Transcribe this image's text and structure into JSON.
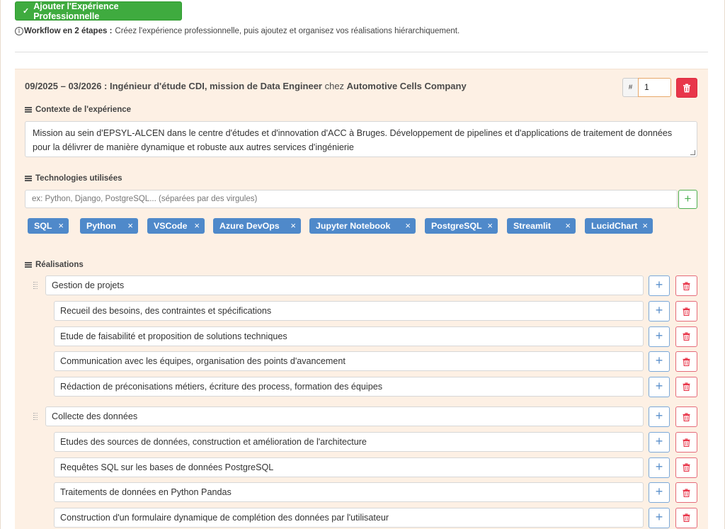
{
  "toolbar": {
    "add_experience_label": "Ajouter l'Expérience Professionnelle"
  },
  "workflow": {
    "title": "Workflow en 2 étapes :",
    "text": "Créez l'expérience professionnelle, puis ajoutez et organisez vos réalisations hiérarchiquement."
  },
  "experience": {
    "period": "09/2025 – 03/2026",
    "separator": " : ",
    "role": "Ingénieur d'étude CDI, mission de Data Engineer",
    "at": " chez ",
    "company": "Automotive Cells Company",
    "order_hash": "#",
    "order_value": "1",
    "context_label": "Contexte de l'expérience",
    "context_text": "Mission au sein d'EPSYL-ALCEN dans le centre d'études et d'innovation d'ACC à Bruges. Développement de pipelines et d'applications de traitement de données pour la délivrer de manière dynamique et robuste aux autres services d'ingénierie",
    "tech_label": "Technologies utilisées",
    "tech_placeholder": "ex: Python, Django, PostgreSQL... (séparées par des virgules)",
    "tech_add": "+",
    "technologies": [
      "SQL",
      "Python",
      "VSCode",
      "Azure DevOps",
      "Jupyter Notebook",
      "PostgreSQL",
      "Streamlit",
      "LucidChart"
    ],
    "tag_remove": "×",
    "achievements_label": "Réalisations",
    "achievements": [
      {
        "title": "Gestion de projets",
        "children": [
          "Recueil des besoins, des contraintes et spécifications",
          "Etude de faisabilité et proposition de solutions techniques",
          "Communication avec les équipes, organisation des points d'avancement",
          "Rédaction de préconisations métiers, écriture des process, formation des équipes"
        ]
      },
      {
        "title": "Collecte des données",
        "children": [
          "Etudes des sources de données, construction et amélioration de l'architecture",
          "Requêtes SQL sur les bases de données PostgreSQL",
          "Traitements de données en Python Pandas",
          "Construction d'un formulaire dynamique de complétion des données par l'utilisateur"
        ]
      }
    ],
    "add_symbol": "+"
  },
  "colors": {
    "success": "#3fab3f",
    "danger": "#e8364a",
    "tag": "#4f89ca",
    "card_bg": "#fdf0e4"
  }
}
